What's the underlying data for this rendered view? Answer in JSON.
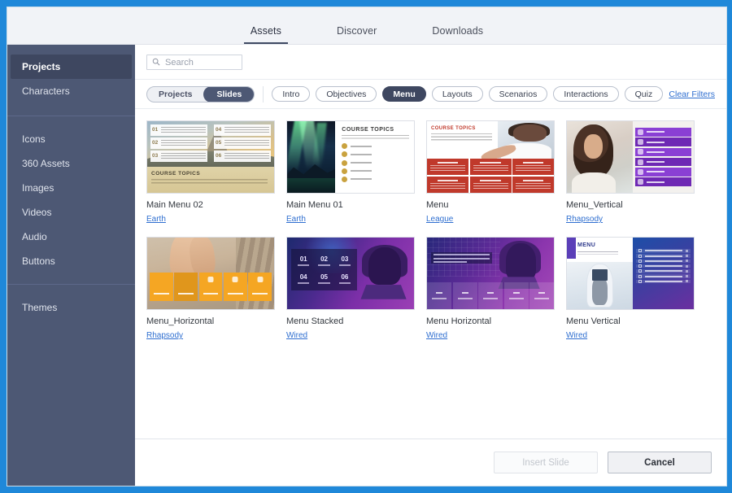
{
  "window": {
    "accent_color": "#1f88d9"
  },
  "tabs": [
    {
      "label": "Assets",
      "active": true
    },
    {
      "label": "Discover",
      "active": false
    },
    {
      "label": "Downloads",
      "active": false
    }
  ],
  "sidebar": {
    "group1": [
      {
        "label": "Projects",
        "active": true
      },
      {
        "label": "Characters",
        "active": false
      }
    ],
    "group2": [
      {
        "label": "Icons"
      },
      {
        "label": "360 Assets"
      },
      {
        "label": "Images"
      },
      {
        "label": "Videos"
      },
      {
        "label": "Audio"
      },
      {
        "label": "Buttons"
      }
    ],
    "group3": [
      {
        "label": "Themes"
      }
    ]
  },
  "search": {
    "placeholder": "Search",
    "value": "",
    "icon": "search-icon"
  },
  "filters": {
    "toggle": [
      {
        "label": "Projects",
        "active": false
      },
      {
        "label": "Slides",
        "active": true
      }
    ],
    "chips": [
      {
        "label": "Intro",
        "active": false
      },
      {
        "label": "Objectives",
        "active": false
      },
      {
        "label": "Menu",
        "active": true
      },
      {
        "label": "Layouts",
        "active": false
      },
      {
        "label": "Scenarios",
        "active": false
      },
      {
        "label": "Interactions",
        "active": false
      },
      {
        "label": "Quiz",
        "active": false
      }
    ],
    "clear_label": "Clear Filters"
  },
  "grid": {
    "cards": [
      {
        "title": "Main Menu 02",
        "link": "Earth",
        "thumb": "mountain-course-topics"
      },
      {
        "title": "Main Menu 01",
        "link": "Earth",
        "thumb": "aurora-course-topics"
      },
      {
        "title": "Menu",
        "link": "League",
        "thumb": "red-tiles-course-topics"
      },
      {
        "title": "Menu_Vertical",
        "link": "Rhapsody",
        "thumb": "purple-vertical-menu"
      },
      {
        "title": "Menu_Horizontal",
        "link": "Rhapsody",
        "thumb": "beach-orange-tiles"
      },
      {
        "title": "Menu Stacked",
        "link": "Wired",
        "thumb": "hacker-number-grid"
      },
      {
        "title": "Menu Horizontal",
        "link": "Wired",
        "thumb": "hacker-horizontal-tiles"
      },
      {
        "title": "Menu Vertical",
        "link": "Wired",
        "thumb": "blue-menu-list"
      }
    ],
    "thumb_text": {
      "course_topics": "COURSE TOPICS",
      "menu": "MENU",
      "numbers_six": [
        "01",
        "02",
        "03",
        "04",
        "05",
        "06"
      ]
    }
  },
  "footer": {
    "insert_label": "Insert Slide",
    "insert_disabled": true,
    "cancel_label": "Cancel"
  }
}
